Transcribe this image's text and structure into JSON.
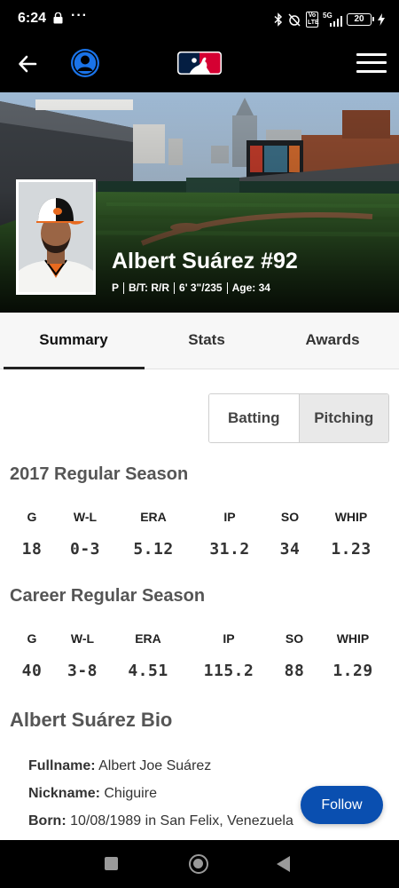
{
  "status_bar": {
    "time": "6:24",
    "dots": "···",
    "network": "5G",
    "volte": "Vo LTE",
    "battery": "20"
  },
  "header": {
    "back_icon": "arrow-left-icon",
    "profile_icon": "user-avatar-icon",
    "logo": "mlb-logo",
    "menu_icon": "hamburger-menu-icon"
  },
  "player": {
    "name": "Albert Suárez #92",
    "position": "P",
    "bats_throws": "B/T: R/R",
    "height_weight": "6' 3\"/235",
    "age": "Age: 34"
  },
  "tabs": [
    {
      "label": "Summary",
      "active": true
    },
    {
      "label": "Stats",
      "active": false
    },
    {
      "label": "Awards",
      "active": false
    }
  ],
  "toggle": {
    "batting": "Batting",
    "pitching": "Pitching",
    "selected": "Pitching"
  },
  "season": {
    "title": "2017 Regular Season",
    "headers": [
      "G",
      "W-L",
      "ERA",
      "IP",
      "SO",
      "WHIP"
    ],
    "values": [
      "18",
      "0-3",
      "5.12",
      "31.2",
      "34",
      "1.23"
    ]
  },
  "career": {
    "title": "Career Regular Season",
    "headers": [
      "G",
      "W-L",
      "ERA",
      "IP",
      "SO",
      "WHIP"
    ],
    "values": [
      "40",
      "3-8",
      "4.51",
      "115.2",
      "88",
      "1.29"
    ]
  },
  "bio": {
    "title": "Albert Suárez Bio",
    "fullname_label": "Fullname:",
    "fullname": "Albert Joe Suárez",
    "nickname_label": "Nickname:",
    "nickname": "Chiguire",
    "born_label": "Born:",
    "born": "10/08/1989 in San Felix, Venezuela"
  },
  "follow_label": "Follow",
  "colors": {
    "accent": "#0a4fb0",
    "avatar": "#1a73e8",
    "mlb_red": "#d50032",
    "mlb_blue": "#041e42"
  }
}
